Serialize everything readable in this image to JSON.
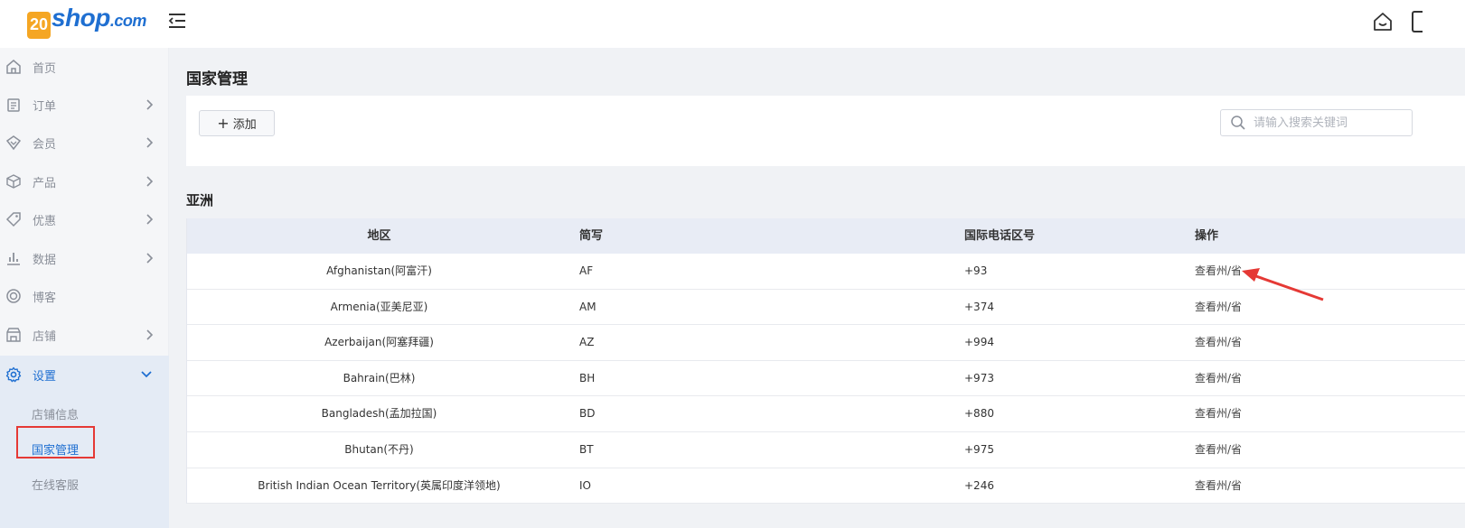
{
  "header": {
    "logo_mark": "20",
    "logo_text": "shop",
    "logo_suffix": ".com"
  },
  "sidebar": {
    "items": [
      {
        "label": "首页",
        "icon": "home-icon",
        "has_children": false
      },
      {
        "label": "订单",
        "icon": "order-icon",
        "has_children": true
      },
      {
        "label": "会员",
        "icon": "member-icon",
        "has_children": true
      },
      {
        "label": "产品",
        "icon": "product-icon",
        "has_children": true
      },
      {
        "label": "优惠",
        "icon": "tag-icon",
        "has_children": true
      },
      {
        "label": "数据",
        "icon": "chart-icon",
        "has_children": true
      },
      {
        "label": "博客",
        "icon": "blog-icon",
        "has_children": false
      },
      {
        "label": "店铺",
        "icon": "store-icon",
        "has_children": true
      },
      {
        "label": "设置",
        "icon": "gear-icon",
        "has_children": true,
        "expanded": true
      }
    ],
    "sub_items": [
      "店铺信息",
      "国家管理",
      "在线客服"
    ],
    "current_sub": "国家管理"
  },
  "main": {
    "page_title": "国家管理",
    "add_button": "添加",
    "search_placeholder": "请输入搜索关键词",
    "section_title": "亚洲",
    "columns": [
      "地区",
      "简写",
      "国际电话区号",
      "操作"
    ],
    "rows": [
      {
        "region": "Afghanistan(阿富汗)",
        "abbr": "AF",
        "tel": "+93",
        "op": "查看州/省"
      },
      {
        "region": "Armenia(亚美尼亚)",
        "abbr": "AM",
        "tel": "+374",
        "op": "查看州/省"
      },
      {
        "region": "Azerbaijan(阿塞拜疆)",
        "abbr": "AZ",
        "tel": "+994",
        "op": "查看州/省"
      },
      {
        "region": "Bahrain(巴林)",
        "abbr": "BH",
        "tel": "+973",
        "op": "查看州/省"
      },
      {
        "region": "Bangladesh(孟加拉国)",
        "abbr": "BD",
        "tel": "+880",
        "op": "查看州/省"
      },
      {
        "region": "Bhutan(不丹)",
        "abbr": "BT",
        "tel": "+975",
        "op": "查看州/省"
      },
      {
        "region": "British Indian Ocean Territory(英属印度洋领地)",
        "abbr": "IO",
        "tel": "+246",
        "op": "查看州/省"
      }
    ]
  },
  "colors": {
    "accent": "#1f6fd1",
    "logo_orange": "#f5a623",
    "annotation_red": "#e53935"
  }
}
